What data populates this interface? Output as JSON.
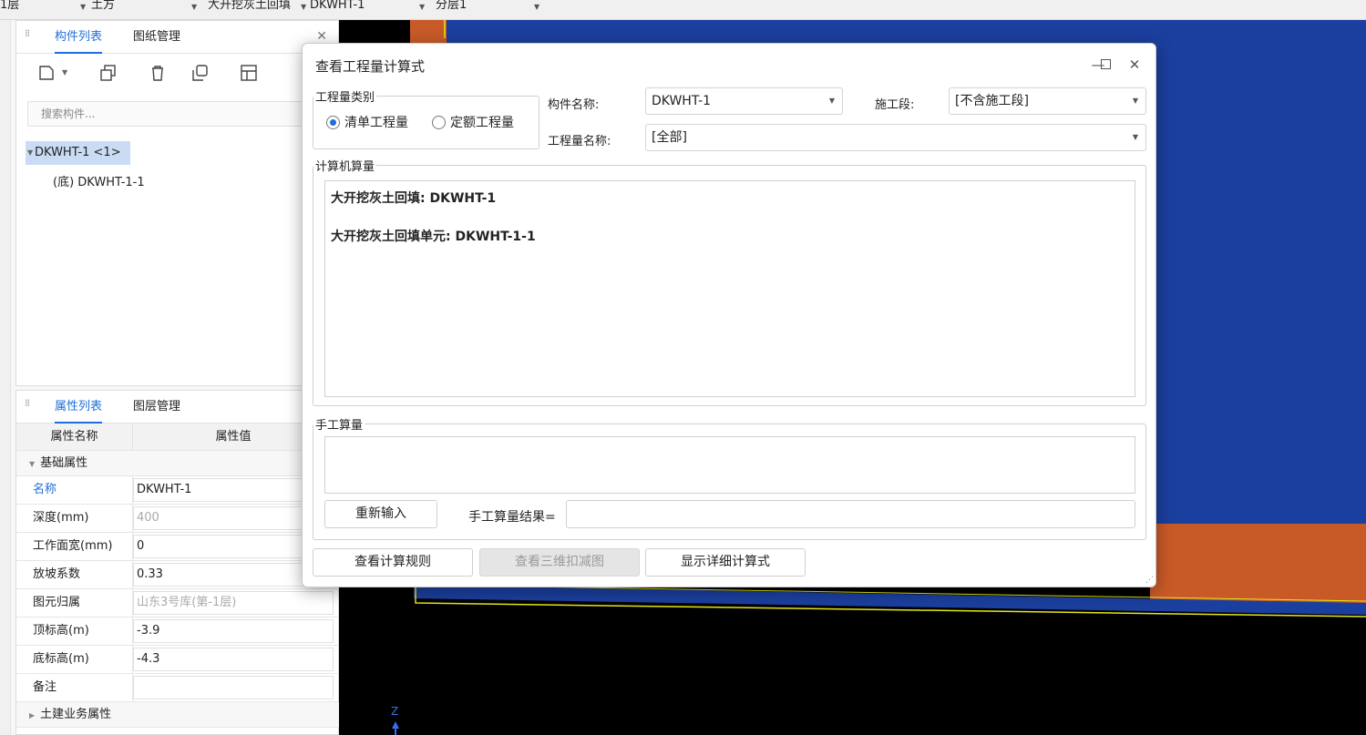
{
  "toolbar": {
    "floor": "1层",
    "category": "土方",
    "component_type": "大开挖灰土回填",
    "component": "DKWHT-1",
    "layer": "分层1"
  },
  "component_panel": {
    "tabs": [
      "构件列表",
      "图纸管理"
    ],
    "search_placeholder": "搜索构件...",
    "tree_root": "DKWHT-1 <1>",
    "tree_child": "(底) DKWHT-1-1"
  },
  "property_panel": {
    "tabs": [
      "属性列表",
      "图层管理"
    ],
    "col_name": "属性名称",
    "col_value": "属性值",
    "group_basic": "基础属性",
    "rows": [
      {
        "name": "名称",
        "value": "DKWHT-1"
      },
      {
        "name": "深度(mm)",
        "value": "400"
      },
      {
        "name": "工作面宽(mm)",
        "value": "0"
      },
      {
        "name": "放坡系数",
        "value": "0.33"
      },
      {
        "name": "图元归属",
        "value": "山东3号库(第-1层)"
      },
      {
        "name": "顶标高(m)",
        "value": "-3.9"
      },
      {
        "name": "底标高(m)",
        "value": "-4.3"
      },
      {
        "name": "备注",
        "value": ""
      }
    ],
    "group_civil": "土建业务属性"
  },
  "canvas": {
    "axis_label": "Z",
    "colors": {
      "background": "#000000",
      "blue": "#1b3f9e",
      "orange": "#c85a28",
      "outline": "#e6e617"
    }
  },
  "dialog": {
    "title": "查看工程量计算式",
    "quantity_type_label": "工程量类别",
    "radio_list": "清单工程量",
    "radio_quota": "定额工程量",
    "component_name_label": "构件名称:",
    "component_name_value": "DKWHT-1",
    "segment_label": "施工段:",
    "segment_value": "[不含施工段]",
    "quantity_name_label": "工程量名称:",
    "quantity_name_value": "[全部]",
    "computer_calc_label": "计算机算量",
    "calc_lines": [
      "大开挖灰土回填: DKWHT-1",
      "大开挖灰土回填单元: DKWHT-1-1"
    ],
    "manual_calc_label": "手工算量",
    "reinput_button": "重新输入",
    "manual_result_label": "手工算量结果=",
    "manual_result_value": "",
    "view_rules_button": "查看计算规则",
    "view_3d_button": "查看三维扣减图",
    "show_detail_button": "显示详细计算式"
  }
}
